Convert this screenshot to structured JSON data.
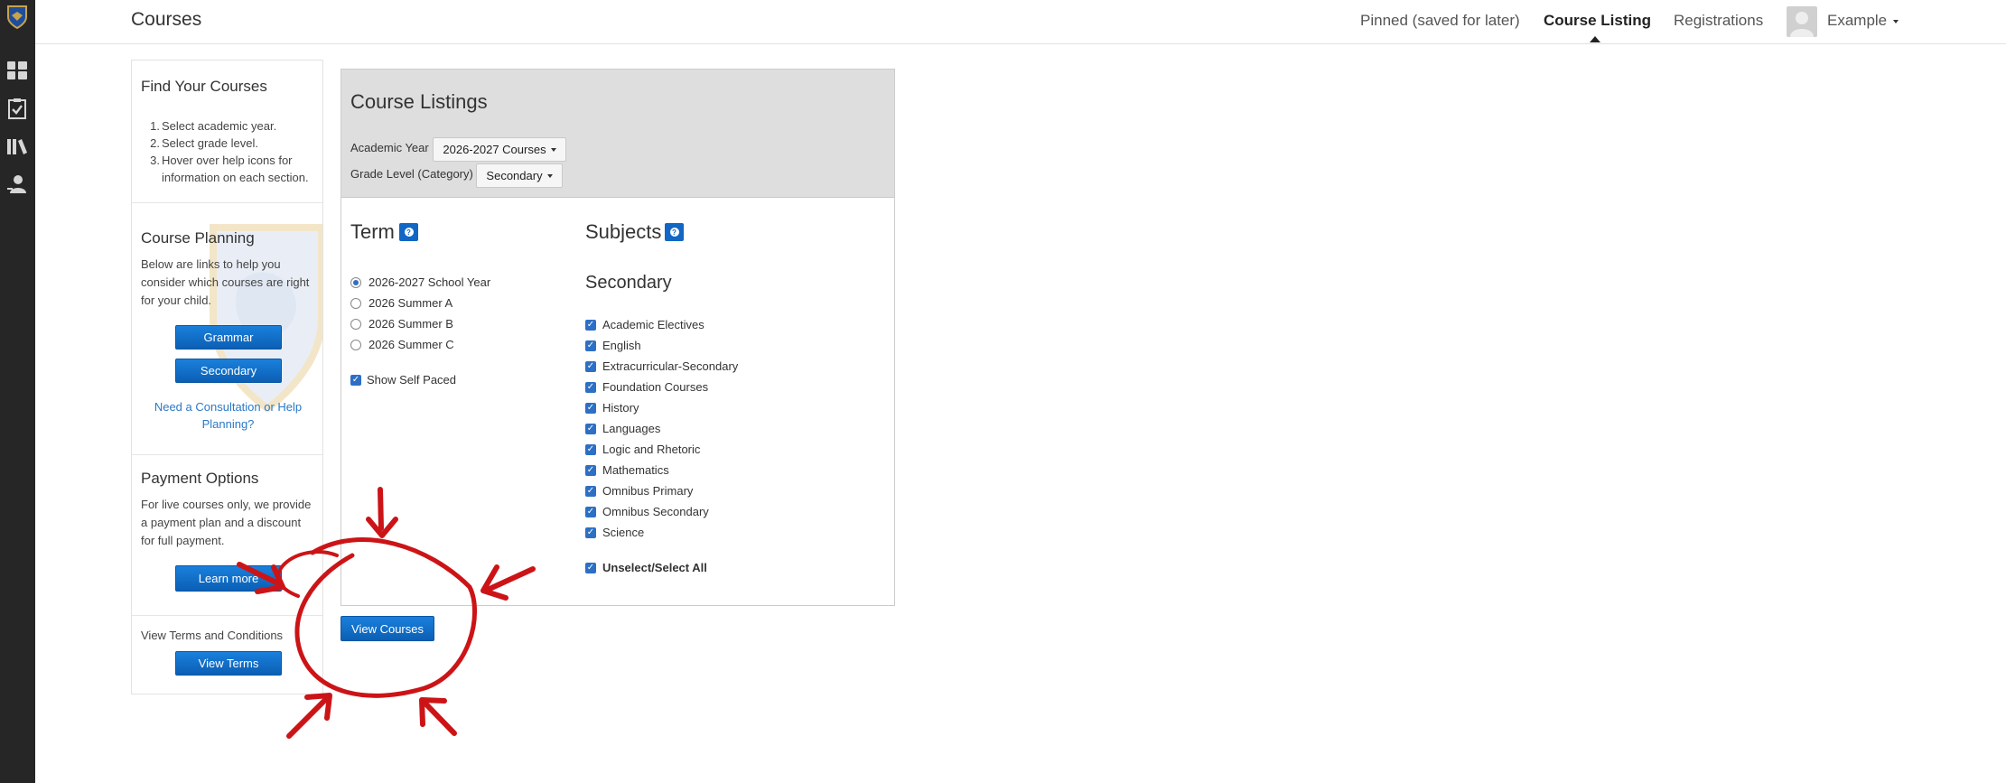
{
  "header": {
    "title": "Courses",
    "nav": [
      "Pinned (saved for later)",
      "Course Listing",
      "Registrations"
    ],
    "user": "Example"
  },
  "rail_icons": [
    "logo-shield-icon",
    "dashboard-grid-icon",
    "checklist-icon",
    "library-icon",
    "user-icon"
  ],
  "sidebar": {
    "find": {
      "title": "Find Your Courses",
      "steps": [
        "Select academic year.",
        "Select grade level.",
        "Hover over help icons for",
        "information on each section."
      ]
    },
    "planning": {
      "title": "Course Planning",
      "text": [
        "Below are links to help you",
        "consider which courses are right",
        "for your child."
      ],
      "buttons": [
        "Grammar",
        "Secondary"
      ],
      "link": [
        "Need a Consultation or Help",
        "Planning?"
      ]
    },
    "payment": {
      "title": "Payment Options",
      "text": [
        "For live courses only, we provide",
        "a payment plan and a discount",
        "for full payment."
      ],
      "button": "Learn more"
    },
    "terms": {
      "text": "View Terms and Conditions",
      "button": "View Terms"
    }
  },
  "listings": {
    "title": "Course Listings",
    "academic_year_label": "Academic Year",
    "academic_year_value": "2026-2027 Courses",
    "grade_level_label": "Grade Level (Category)",
    "grade_level_value": "Secondary",
    "term_title": "Term",
    "terms": [
      "2026-2027 School Year",
      "2026 Summer A",
      "2026 Summer B",
      "2026 Summer C"
    ],
    "selected_term": "2026-2027 School Year",
    "self_paced": "Show Self Paced",
    "subjects_title": "Subjects",
    "subjects_group": "Secondary",
    "subjects": [
      "Academic Electives",
      "English",
      "Extracurricular-Secondary",
      "Foundation Courses",
      "History",
      "Languages",
      "Logic and Rhetoric",
      "Mathematics",
      "Omnibus Primary",
      "Omnibus Secondary",
      "Science"
    ],
    "select_all": "Unselect/Select All",
    "view_button": "View Courses"
  },
  "colors": {
    "rail": "#262626",
    "primary_blue": "#0b5fb4",
    "panel_header": "#dedede",
    "annotation_red": "#cc1417"
  }
}
